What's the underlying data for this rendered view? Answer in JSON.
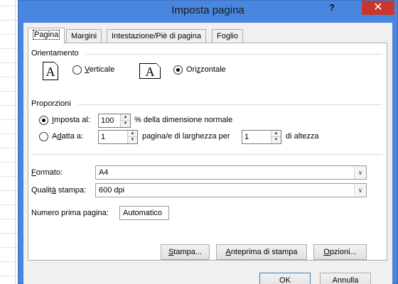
{
  "window": {
    "title": "Imposta pagina",
    "help_glyph": "?",
    "close_glyph": "✕"
  },
  "tabs": [
    {
      "label": "Pagina",
      "active": true
    },
    {
      "label": "Margini",
      "active": false
    },
    {
      "label": "Intestazione/Piè di pagina",
      "active": false
    },
    {
      "label": "Foglio",
      "active": false
    }
  ],
  "orientation": {
    "group_label": "Orientamento",
    "icon_letter": "A",
    "portrait_label_pre": "",
    "portrait_label_key": "V",
    "portrait_label_post": "erticale",
    "landscape_label_pre": "Ori",
    "landscape_label_key": "z",
    "landscape_label_post": "zontale",
    "selected": "landscape"
  },
  "scaling": {
    "group_label": "Proporzioni",
    "adjust_label_key": "I",
    "adjust_label_post": "mposta al:",
    "adjust_value": "100",
    "adjust_suffix": "% della dimensione normale",
    "fit_label_pre": "A",
    "fit_label_key": "d",
    "fit_label_post": "atta a:",
    "fit_wide_value": "1",
    "fit_middle": "pagina/e di larghezza per",
    "fit_tall_value": "1",
    "fit_suffix": "di altezza",
    "selected": "adjust"
  },
  "paper": {
    "format_label_key": "F",
    "format_label_post": "ormato:",
    "format_value": "A4",
    "quality_label_pre": "Qualit",
    "quality_label_key": "à",
    "quality_label_post": " stampa:",
    "quality_value": "600 dpi",
    "first_page_label": "Numero prima pagina:",
    "first_page_value": "Automatico"
  },
  "panel_buttons": {
    "print_key": "S",
    "print_post": "tampa...",
    "preview_pre": "",
    "preview_key": "A",
    "preview_post": "nteprima di stampa",
    "options_key": "O",
    "options_post": "pzioni..."
  },
  "footer": {
    "ok_label": "OK",
    "cancel_label": "Annulla"
  },
  "icons": {
    "spin_up": "▲",
    "spin_down": "▼",
    "drop": "∨"
  },
  "colors": {
    "titlebar": "#4a86dd",
    "close": "#c7372f",
    "client": "#f0f0f0"
  }
}
